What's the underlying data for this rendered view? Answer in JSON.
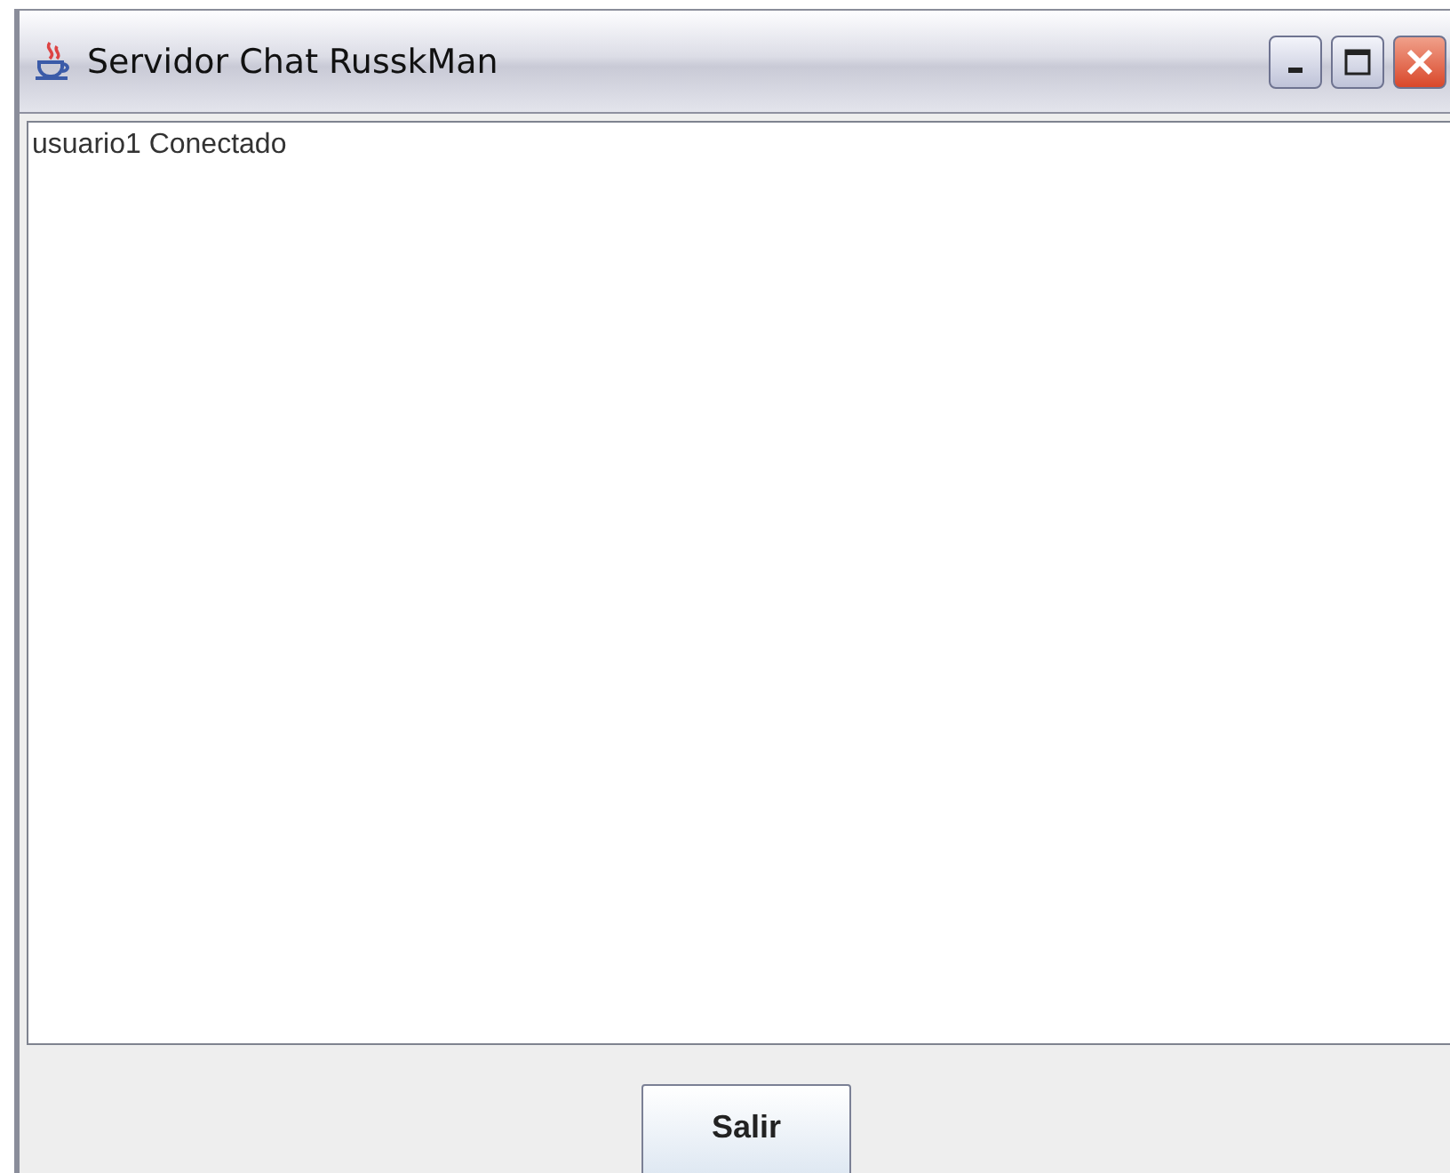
{
  "window": {
    "title": "Servidor Chat RusskMan"
  },
  "log": {
    "lines": [
      "usuario1 Conectado"
    ]
  },
  "buttons": [
    "Salir"
  ]
}
